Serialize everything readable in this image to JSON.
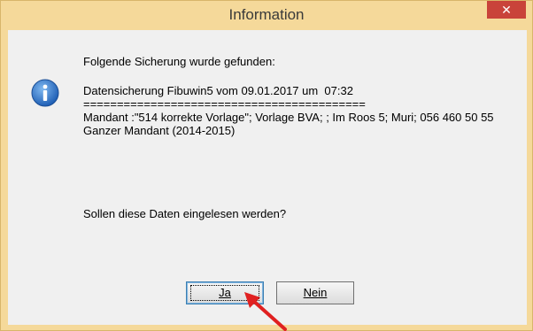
{
  "window": {
    "title": "Information",
    "close_symbol": "✕"
  },
  "message": {
    "line1": "Folgende Sicherung wurde gefunden:",
    "line2": "Datensicherung Fibuwin5 vom 09.01.2017 um  07:32",
    "separator": "==========================================",
    "line3": "Mandant :\"514 korrekte Vorlage\"; Vorlage BVA; ; Im Roos 5; Muri; 056 460 50 55",
    "line4": "Ganzer Mandant (2014-2015)",
    "question": "Sollen diese Daten eingelesen werden?"
  },
  "buttons": {
    "yes_label": "Ja",
    "no_label": "Nein"
  },
  "icons": {
    "message_icon": "info-icon",
    "annotation": "red-arrow-icon"
  },
  "colors": {
    "title_bar": "#f5d99a",
    "close_button": "#c9433a",
    "arrow": "#e02020",
    "info_icon": "#1f5fb5"
  }
}
